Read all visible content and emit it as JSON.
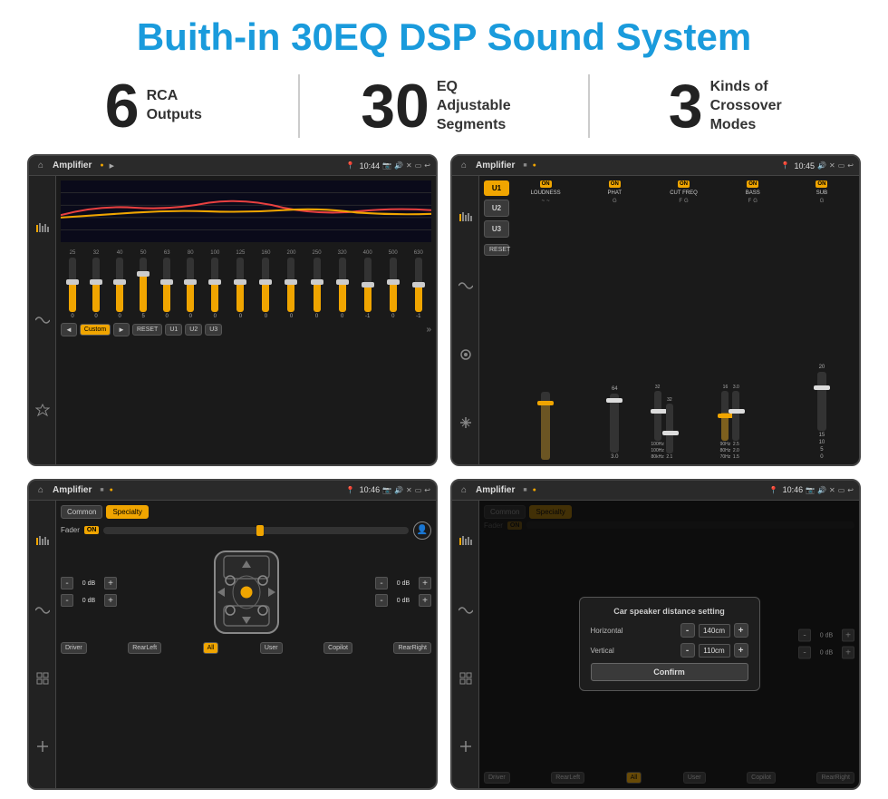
{
  "page": {
    "title": "Buith-in 30EQ DSP Sound System",
    "bg_color": "#ffffff"
  },
  "stats": [
    {
      "number": "6",
      "label_line1": "RCA",
      "label_line2": "Outputs"
    },
    {
      "number": "30",
      "label_line1": "EQ Adjustable",
      "label_line2": "Segments"
    },
    {
      "number": "3",
      "label_line1": "Kinds of",
      "label_line2": "Crossover Modes"
    }
  ],
  "screens": [
    {
      "id": "eq-screen",
      "title": "Amplifier",
      "time": "10:44",
      "type": "eq",
      "freqs": [
        "25",
        "32",
        "40",
        "50",
        "63",
        "80",
        "100",
        "125",
        "160",
        "200",
        "250",
        "320",
        "400",
        "500",
        "630"
      ],
      "values": [
        "0",
        "0",
        "0",
        "5",
        "0",
        "0",
        "0",
        "0",
        "0",
        "0",
        "0",
        "0",
        "-1",
        "0",
        "-1"
      ],
      "preset": "Custom",
      "buttons": [
        "RESET",
        "U1",
        "U2",
        "U3"
      ]
    },
    {
      "id": "crossover-screen",
      "title": "Amplifier",
      "time": "10:45",
      "type": "crossover",
      "presets": [
        "U1",
        "U2",
        "U3"
      ],
      "channels": [
        "LOUDNESS",
        "PHAT",
        "CUT FREQ",
        "BASS",
        "SUB"
      ],
      "reset_label": "RESET"
    },
    {
      "id": "speaker-screen",
      "title": "Amplifier",
      "time": "10:46",
      "type": "speaker",
      "tabs": [
        "Common",
        "Specialty"
      ],
      "fader_label": "Fader",
      "fader_on": "ON",
      "db_values": [
        "0 dB",
        "0 dB",
        "0 dB",
        "0 dB"
      ],
      "footer_buttons": [
        "Driver",
        "RearLeft",
        "All",
        "User",
        "Copilot",
        "RearRight"
      ]
    },
    {
      "id": "speaker-distance-screen",
      "title": "Amplifier",
      "time": "10:46",
      "type": "speaker-distance",
      "tabs": [
        "Common",
        "Specialty"
      ],
      "dialog": {
        "title": "Car speaker distance setting",
        "horizontal_label": "Horizontal",
        "horizontal_value": "140cm",
        "vertical_label": "Vertical",
        "vertical_value": "110cm",
        "confirm_label": "Confirm"
      },
      "db_values": [
        "0 dB",
        "0 dB"
      ],
      "footer_buttons": [
        "Driver",
        "RearLeft",
        "All",
        "User",
        "Copilot",
        "RearRight"
      ]
    }
  ],
  "icons": {
    "home": "⌂",
    "eq_icon": "≈",
    "wave_icon": "∿",
    "vol_icon": "◈",
    "settings_icon": "⚙",
    "person_icon": "👤",
    "arrow_left": "◄",
    "arrow_right": "►",
    "chevron_down": "▼",
    "chevron_up": "▲",
    "pin_icon": "📍",
    "camera_icon": "📷",
    "speaker_icon": "🔊",
    "cross_icon": "✕",
    "window_icon": "▭",
    "back_icon": "↩"
  }
}
